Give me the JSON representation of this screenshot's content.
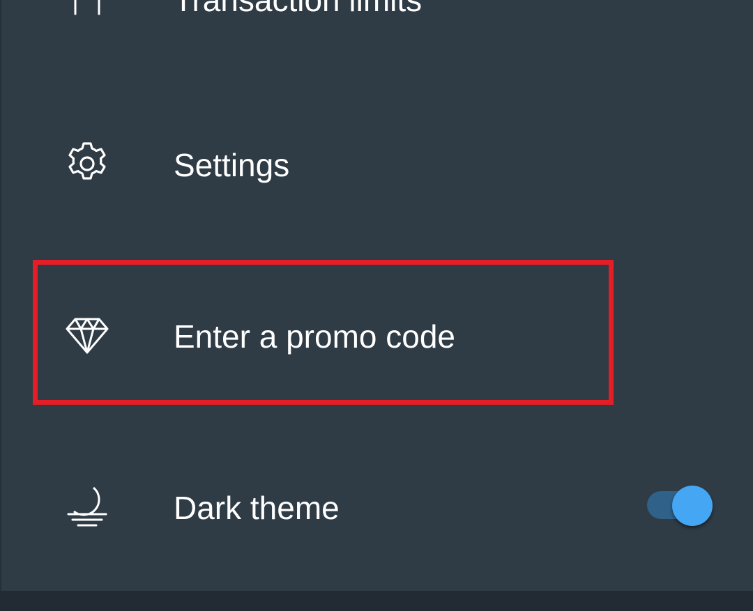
{
  "menu": {
    "items": [
      {
        "id": "limits",
        "label": "Transaction limits",
        "icon": "limits-icon"
      },
      {
        "id": "settings",
        "label": "Settings",
        "icon": "gear-icon"
      },
      {
        "id": "promo",
        "label": "Enter a promo code",
        "icon": "diamond-icon"
      },
      {
        "id": "dark",
        "label": "Dark theme",
        "icon": "moon-icon"
      }
    ],
    "dark_theme_enabled": true
  },
  "colors": {
    "background": "#2f3b45",
    "text": "#ffffff",
    "highlight_border": "#e41d26",
    "toggle_thumb": "#45a6f3",
    "toggle_track": "#2f6189",
    "bottom_bar": "#222b33"
  }
}
